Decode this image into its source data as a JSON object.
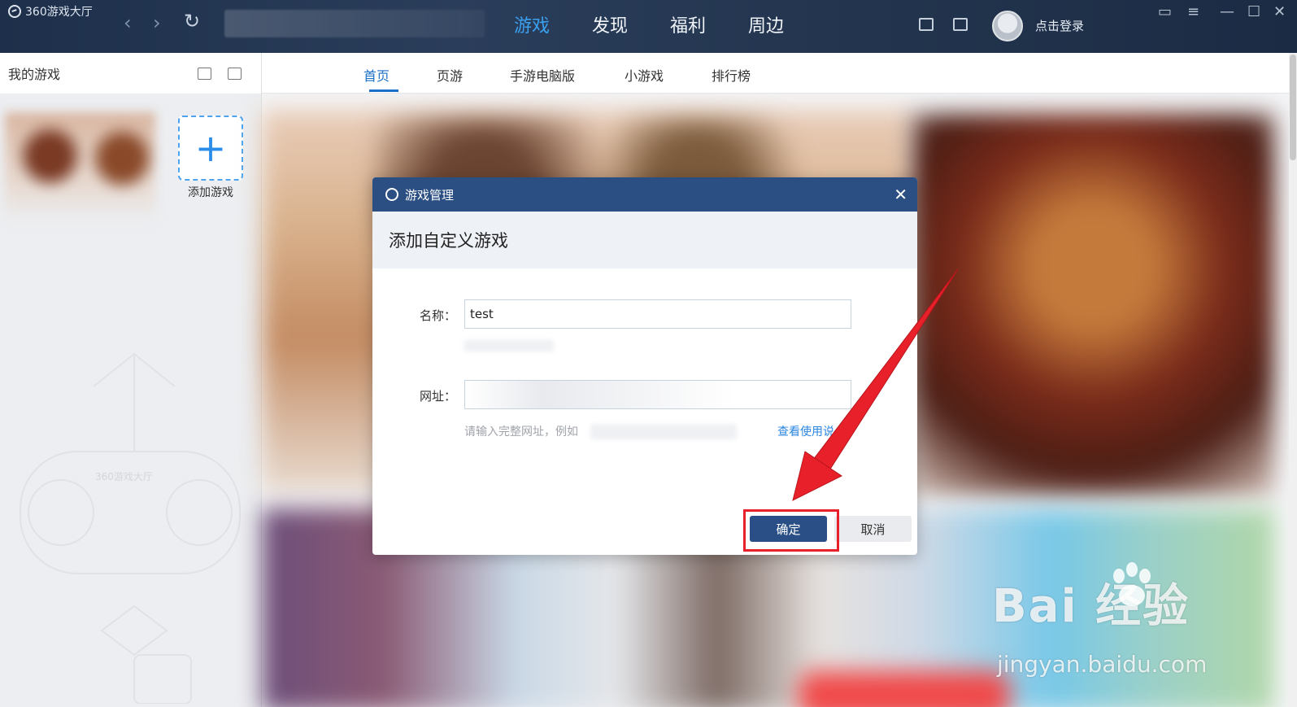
{
  "app": {
    "name": "360游戏大厅"
  },
  "topnav": {
    "items": [
      {
        "label": "游戏",
        "active": true
      },
      {
        "label": "发现",
        "active": false
      },
      {
        "label": "福利",
        "active": false
      },
      {
        "label": "周边",
        "active": false
      }
    ],
    "login_label": "点击登录"
  },
  "sidebar": {
    "title": "我的游戏",
    "add_game_label": "添加游戏",
    "watermark": "360游戏大厅"
  },
  "tabs": [
    {
      "label": "首页",
      "active": true
    },
    {
      "label": "页游",
      "active": false
    },
    {
      "label": "手游电脑版",
      "active": false
    },
    {
      "label": "小游戏",
      "active": false
    },
    {
      "label": "排行榜",
      "active": false
    }
  ],
  "dialog": {
    "title": "游戏管理",
    "subtitle": "添加自定义游戏",
    "name_label": "名称：",
    "name_value": "test",
    "url_label": "网址：",
    "url_hint": "请输入完整网址，例如",
    "help_link": "查看使用说",
    "ok_label": "确定",
    "cancel_label": "取消"
  },
  "watermark": {
    "brand": "Bai  经验",
    "url": "jingyan.baidu.com"
  },
  "colors": {
    "accent": "#3aa0f0",
    "dialog_header": "#2c4f83",
    "highlight": "#e8202a"
  }
}
